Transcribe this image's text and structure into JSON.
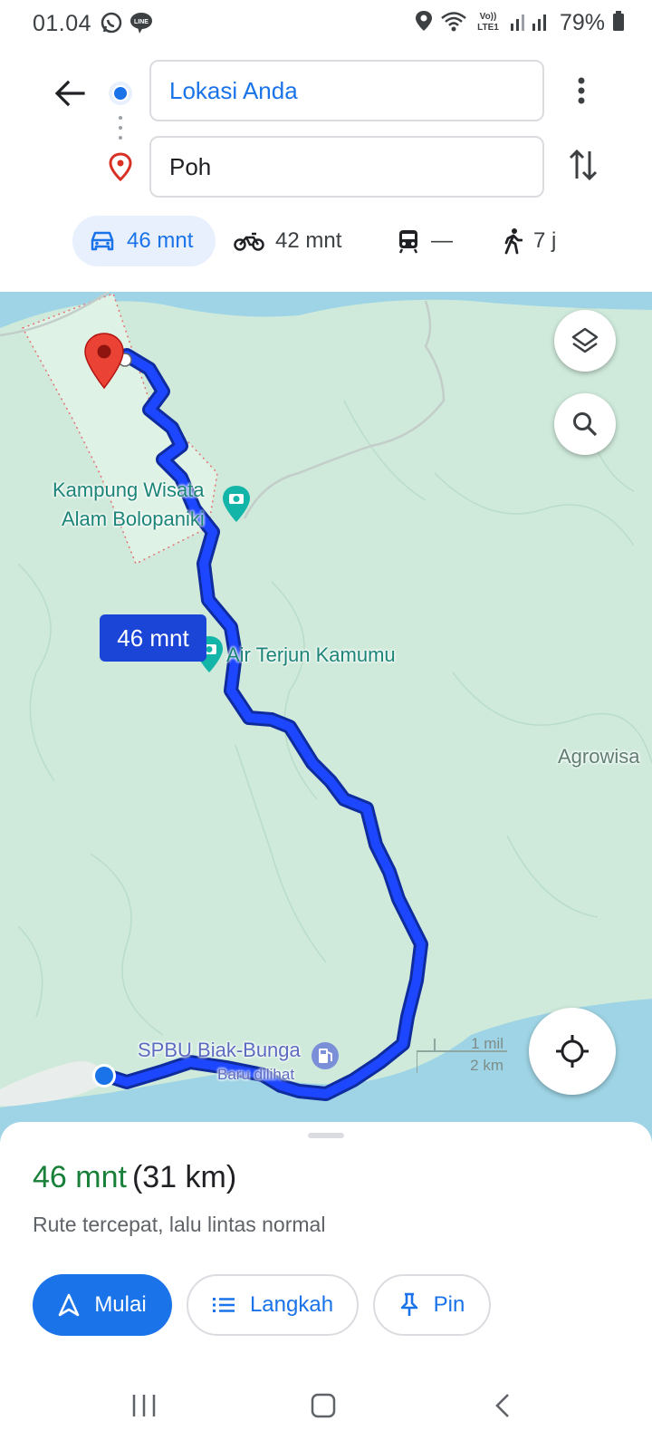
{
  "status_bar": {
    "time": "01.04",
    "battery": "79%",
    "icons": [
      "whatsapp-icon",
      "line-icon",
      "location-icon",
      "wifi-icon",
      "volte-icon",
      "signal-icon",
      "battery-icon"
    ],
    "volte_line1": "Vo))",
    "volte_line2": "LTE1",
    "line_label": "LINE"
  },
  "directions": {
    "origin": "Lokasi Anda",
    "destination": "Poh"
  },
  "modes": [
    {
      "name": "car",
      "time": "46 mnt",
      "selected": true
    },
    {
      "name": "motorcycle",
      "time": "42 mnt"
    },
    {
      "name": "transit",
      "time": "—"
    },
    {
      "name": "walk",
      "time": "7 j"
    }
  ],
  "map": {
    "labels": {
      "poi_1_line1": "Kampung Wisata",
      "poi_1_line2": "Alam Bolopaniki",
      "poi_2": "Air Terjun Kamumu",
      "poi_3": "Agrowisa",
      "poi_4": "SPBU Biak-Bunga",
      "poi_4_sub": "Baru dilihat"
    },
    "route_time": "46 mnt",
    "scale_mi": "1 mil",
    "scale_km": "2 km",
    "colors": {
      "land": "#cfeadb",
      "water": "#9ed4e5",
      "route": "#1a45d6",
      "pin": "#d93025"
    }
  },
  "sheet": {
    "summary_time": "46 mnt",
    "summary_distance": "(31 km)",
    "description": "Rute tercepat, lalu lintas normal",
    "buttons": {
      "start": "Mulai",
      "steps": "Langkah",
      "pin": "Pin"
    }
  }
}
